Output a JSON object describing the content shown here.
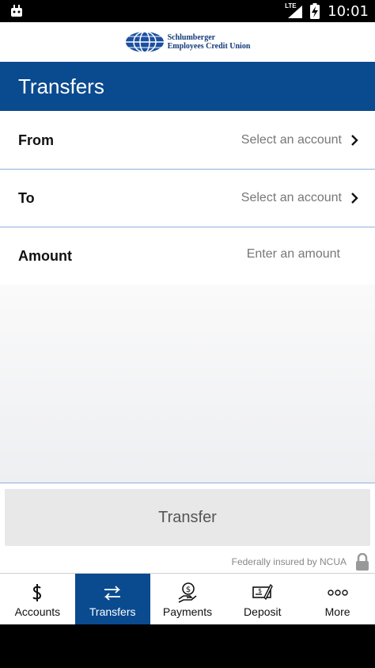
{
  "status_bar": {
    "time": "10:01",
    "network": "LTE"
  },
  "brand": {
    "line1": "Schlumberger",
    "line2": "Employees Credit Union"
  },
  "header": {
    "title": "Transfers"
  },
  "form": {
    "from": {
      "label": "From",
      "value": "Select an account"
    },
    "to": {
      "label": "To",
      "value": "Select an account"
    },
    "amount": {
      "label": "Amount",
      "placeholder": "Enter an amount"
    }
  },
  "transfer_button": {
    "label": "Transfer"
  },
  "footer": {
    "insured_text": "Federally insured by NCUA"
  },
  "nav": {
    "items": [
      {
        "label": "Accounts",
        "icon": "dollar-icon"
      },
      {
        "label": "Transfers",
        "icon": "transfer-arrows-icon"
      },
      {
        "label": "Payments",
        "icon": "hand-dollar-icon"
      },
      {
        "label": "Deposit",
        "icon": "check-deposit-icon"
      },
      {
        "label": "More",
        "icon": "more-dots-icon"
      }
    ],
    "active": "Transfers"
  },
  "colors": {
    "brand_blue": "#0a4a8f",
    "divider": "#8fb2d8",
    "button_gray": "#e8e8e8"
  }
}
